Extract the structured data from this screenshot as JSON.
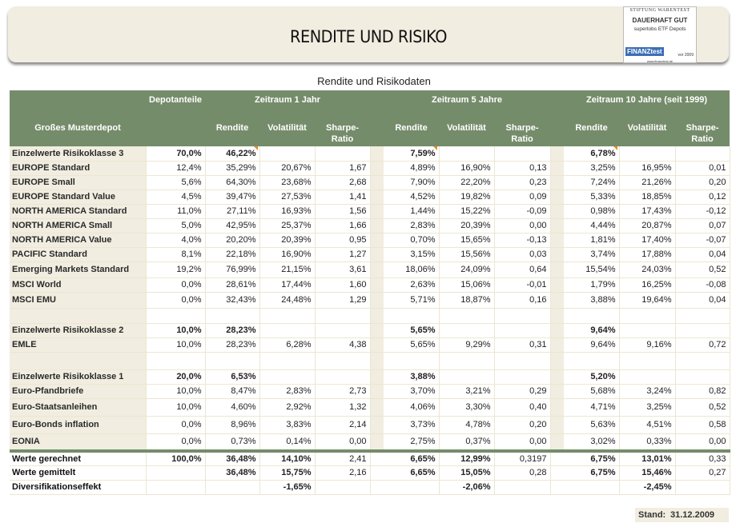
{
  "banner": {
    "title": "RENDITE UND RISIKO"
  },
  "logo": {
    "org": "STIFTUNG WARENTEST",
    "rating": "DAUERHAFT GUT",
    "subject": "supertobs ETF Depots",
    "brand": "FINANZtest",
    "year": "vor 2009",
    "url": "www.finanztest.de"
  },
  "caption": "Rendite und Risikodaten",
  "header": {
    "depot": "Depotanteile",
    "p1": "Zeitraum 1 Jahr",
    "p5": "Zeitraum 5 Jahre",
    "p10": "Zeitraum 10 Jahre (seit 1999)",
    "name": "Großes Musterdepot",
    "rendite": "Rendite",
    "vol": "Volatilität",
    "sharpe": "Sharpe-Ratio"
  },
  "rows": [
    {
      "type": "group",
      "label": "Einzelwerte Risikoklasse 3",
      "v": [
        "70,0%",
        "46,22%",
        "",
        "",
        "7,59%",
        "",
        "",
        "6,78%",
        "",
        ""
      ],
      "marks": [
        1,
        4,
        7
      ]
    },
    {
      "type": "item",
      "label": "EUROPE Standard",
      "v": [
        "12,4%",
        "35,29%",
        "20,67%",
        "1,67",
        "4,89%",
        "16,90%",
        "0,13",
        "3,25%",
        "16,95%",
        "0,01"
      ]
    },
    {
      "type": "item",
      "label": "EUROPE Small",
      "v": [
        "5,6%",
        "64,30%",
        "23,68%",
        "2,68",
        "7,90%",
        "22,20%",
        "0,23",
        "7,24%",
        "21,26%",
        "0,20"
      ]
    },
    {
      "type": "item",
      "label": "EUROPE Standard Value",
      "v": [
        "4,5%",
        "39,47%",
        "27,53%",
        "1,41",
        "4,52%",
        "19,82%",
        "0,09",
        "5,33%",
        "18,85%",
        "0,12"
      ]
    },
    {
      "type": "item",
      "label": "NORTH AMERICA Standard",
      "v": [
        "11,0%",
        "27,11%",
        "16,93%",
        "1,56",
        "1,44%",
        "15,22%",
        "-0,09",
        "0,98%",
        "17,43%",
        "-0,12"
      ]
    },
    {
      "type": "item",
      "label": "NORTH AMERICA Small",
      "v": [
        "5,0%",
        "42,95%",
        "25,37%",
        "1,66",
        "2,83%",
        "20,39%",
        "0,00",
        "4,44%",
        "20,87%",
        "0,07"
      ]
    },
    {
      "type": "item",
      "label": "NORTH AMERICA Value",
      "v": [
        "4,0%",
        "20,20%",
        "20,39%",
        "0,95",
        "0,70%",
        "15,65%",
        "-0,13",
        "1,81%",
        "17,40%",
        "-0,07"
      ]
    },
    {
      "type": "item",
      "label": "PACIFIC Standard",
      "v": [
        "8,1%",
        "22,18%",
        "16,90%",
        "1,27",
        "3,15%",
        "15,56%",
        "0,03",
        "3,74%",
        "17,88%",
        "0,04"
      ]
    },
    {
      "type": "item",
      "label": "Emerging Markets Standard",
      "v": [
        "19,2%",
        "76,99%",
        "21,15%",
        "3,61",
        "18,06%",
        "24,09%",
        "0,64",
        "15,54%",
        "24,03%",
        "0,52"
      ],
      "h": 20
    },
    {
      "type": "item",
      "label": "MSCI World",
      "v": [
        "0,0%",
        "28,61%",
        "17,44%",
        "1,60",
        "2,63%",
        "15,06%",
        "-0,01",
        "1,79%",
        "16,25%",
        "-0,08"
      ]
    },
    {
      "type": "item",
      "label": "MSCI EMU",
      "v": [
        "0,0%",
        "32,43%",
        "24,48%",
        "1,29",
        "5,71%",
        "18,87%",
        "0,16",
        "3,88%",
        "19,64%",
        "0,04"
      ],
      "h": 20
    },
    {
      "type": "blank",
      "label": "",
      "v": [
        "",
        "",
        "",
        "",
        "",
        "",
        "",
        "",
        "",
        ""
      ],
      "h": 19
    },
    {
      "type": "group",
      "label": "Einzelwerte Risikoklasse 2",
      "v": [
        "10,0%",
        "28,23%",
        "",
        "",
        "5,65%",
        "",
        "",
        "9,64%",
        "",
        ""
      ]
    },
    {
      "type": "item",
      "label": "EMLE",
      "v": [
        "10,0%",
        "28,23%",
        "6,28%",
        "4,38",
        "5,65%",
        "9,29%",
        "0,31",
        "9,64%",
        "9,16%",
        "0,72"
      ]
    },
    {
      "type": "blank",
      "label": "",
      "v": [
        "",
        "",
        "",
        "",
        "",
        "",
        "",
        "",
        "",
        ""
      ],
      "h": 22
    },
    {
      "type": "group",
      "label": "Einzelwerte Risikoklasse 1",
      "v": [
        "20,0%",
        "6,53%",
        "",
        "",
        "3,88%",
        "",
        "",
        "5,20%",
        "",
        ""
      ]
    },
    {
      "type": "item",
      "label": "Euro-Pfandbriefe",
      "v": [
        "10,0%",
        "8,47%",
        "2,83%",
        "2,73",
        "3,70%",
        "3,21%",
        "0,29",
        "5,68%",
        "3,24%",
        "0,82"
      ]
    },
    {
      "type": "item",
      "label": "Euro-Staatsanleihen",
      "v": [
        "10,0%",
        "4,60%",
        "2,92%",
        "1,32",
        "4,06%",
        "3,30%",
        "0,40",
        "4,71%",
        "3,25%",
        "0,52"
      ],
      "h": 22
    },
    {
      "type": "item",
      "label": "Euro-Bonds inflation",
      "v": [
        "0,0%",
        "8,96%",
        "3,83%",
        "2,14",
        "3,73%",
        "4,78%",
        "0,20",
        "5,63%",
        "4,51%",
        "0,58"
      ],
      "h": 22
    },
    {
      "type": "item",
      "label": "EONIA",
      "v": [
        "0,0%",
        "0,73%",
        "0,14%",
        "0,00",
        "2,75%",
        "0,37%",
        "0,00",
        "3,02%",
        "0,33%",
        "0,00"
      ],
      "h": 22
    },
    {
      "type": "total",
      "label": "Werte gerechnet",
      "v": [
        "100,0%",
        "36,48%",
        "14,10%",
        "2,41",
        "6,65%",
        "12,99%",
        "0,3197",
        "6,75%",
        "13,01%",
        "0,33"
      ]
    },
    {
      "type": "total",
      "label": "Werte gemittelt",
      "v": [
        "",
        "36,48%",
        "15,75%",
        "2,16",
        "6,65%",
        "15,05%",
        "0,28",
        "6,75%",
        "15,46%",
        "0,27"
      ]
    },
    {
      "type": "total",
      "label": "Diversifikationseffekt",
      "v": [
        "",
        "",
        "-1,65%",
        "",
        "",
        "-2,06%",
        "",
        "",
        "-2,45%",
        ""
      ]
    }
  ],
  "footer": {
    "stand_label": "Stand:",
    "stand_date": "31.12.2009"
  },
  "colors": {
    "header_green": "#758c6a",
    "beige": "#f1ede0",
    "marker_orange": "#e8892a"
  }
}
